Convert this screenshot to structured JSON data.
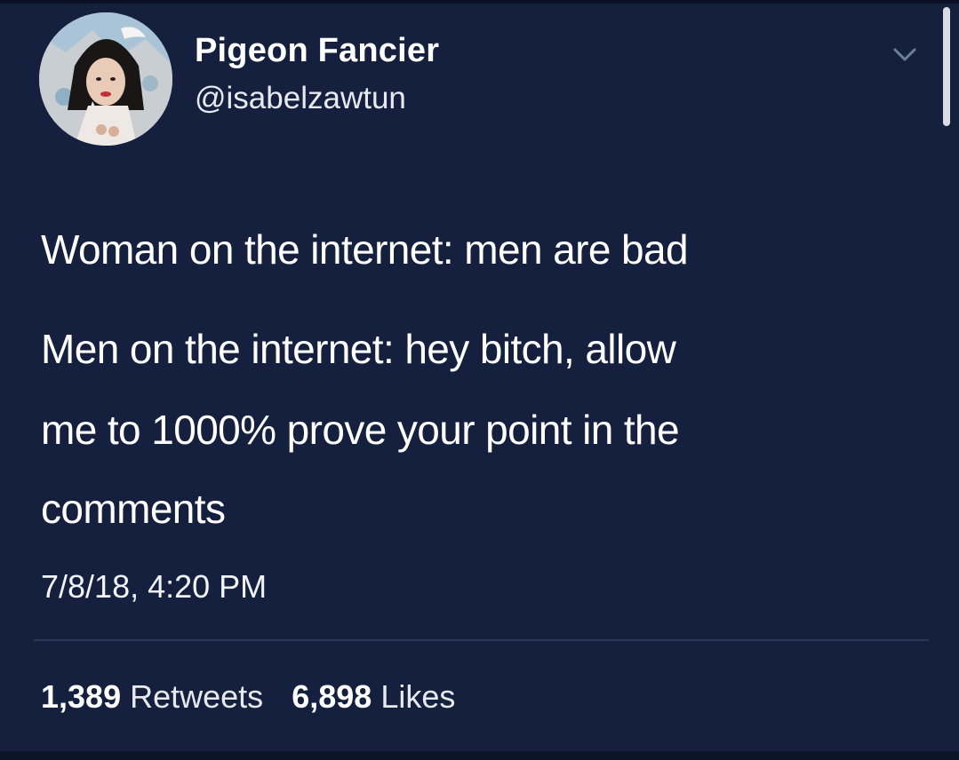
{
  "author": {
    "display_name": "Pigeon Fancier",
    "handle": "@isabelzawtun",
    "avatar_icon": "profile-photo"
  },
  "header": {
    "menu_icon": "chevron-down-icon"
  },
  "tweet": {
    "lines": [
      "Woman on the internet: men are bad",
      "Men on the internet: hey bitch, allow",
      "me to 1000% prove your point in the",
      "comments"
    ],
    "timestamp": "7/8/18, 4:20 PM"
  },
  "stats": {
    "retweets_count": "1,389",
    "retweets_label": "Retweets",
    "likes_count": "6,898",
    "likes_label": "Likes"
  },
  "colors": {
    "background": "#14203d",
    "text": "#ffffff",
    "divider": "#2b3757"
  }
}
